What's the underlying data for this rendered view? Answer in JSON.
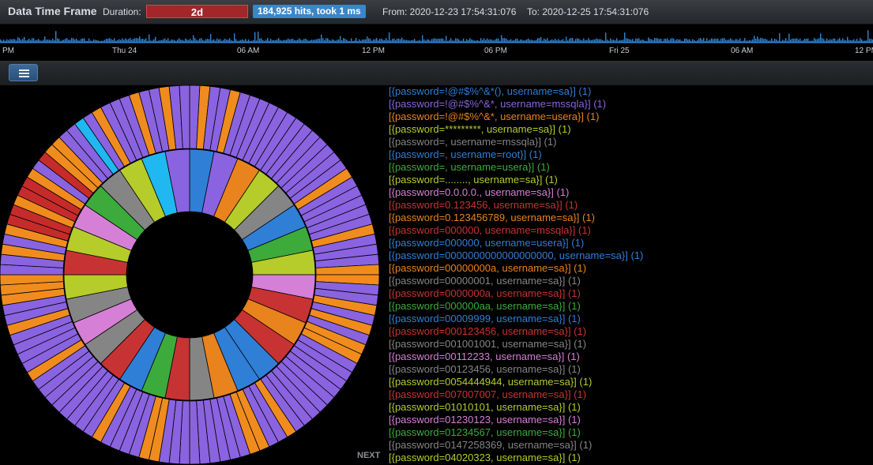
{
  "header": {
    "title": "Data Time Frame",
    "duration_label": "Duration:",
    "duration_value": "2d",
    "hits_badge": "184,925 hits, took 1 ms",
    "from": "From: 2020-12-23 17:54:31:076",
    "to": "To: 2020-12-25 17:54:31:076"
  },
  "timeline": {
    "ticks": [
      "PM",
      "Thu 24",
      "06 AM",
      "12 PM",
      "06 PM",
      "Fri 25",
      "06 AM",
      "12 PM"
    ],
    "bar_color": "#2e86d6"
  },
  "toolbar": {
    "menu_icon": "hamburger-menu-icon"
  },
  "legend": {
    "next_label": "NEXT",
    "items": [
      {
        "text": "[{password=!@#$%^&*(), username=sa}] (1)",
        "color": "#2f7fd6"
      },
      {
        "text": "[{password=!@#$%^&*, username=mssqla}] (1)",
        "color": "#8a63e0"
      },
      {
        "text": "[{password=!@#$%^&*, username=usera}] (1)",
        "color": "#e9831d"
      },
      {
        "text": "[{password=*********, username=sa}] (1)",
        "color": "#b5cc2b"
      },
      {
        "text": "[{password=, username=mssqla}] (1)",
        "color": "#858585"
      },
      {
        "text": "[{password=, username=root}] (1)",
        "color": "#2f7fd6"
      },
      {
        "text": "[{password=, username=usera}] (1)",
        "color": "#3cab3c"
      },
      {
        "text": "[{password=........, username=sa}] (1)",
        "color": "#b5cc2b"
      },
      {
        "text": "[{password=0.0.0.0., username=sa}] (1)",
        "color": "#d67fd6"
      },
      {
        "text": "[{password=0.123456, username=sa}] (1)",
        "color": "#c73333"
      },
      {
        "text": "[{password=0.123456789, username=sa}] (1)",
        "color": "#e9831d"
      },
      {
        "text": "[{password=000000, username=mssqla}] (1)",
        "color": "#c73333"
      },
      {
        "text": "[{password=000000, username=usera}] (1)",
        "color": "#2f7fd6"
      },
      {
        "text": "[{password=0000000000000000000, username=sa}] (1)",
        "color": "#2f7fd6"
      },
      {
        "text": "[{password=00000000a, username=sa}] (1)",
        "color": "#e9831d"
      },
      {
        "text": "[{password=00000001, username=sa}] (1)",
        "color": "#858585"
      },
      {
        "text": "[{password=0000000a, username=sa}] (1)",
        "color": "#c73333"
      },
      {
        "text": "[{password=000000aa, username=sa}] (1)",
        "color": "#3cab3c"
      },
      {
        "text": "[{password=00009999, username=sa}] (1)",
        "color": "#2f7fd6"
      },
      {
        "text": "[{password=000123456, username=sa}] (1)",
        "color": "#c73333"
      },
      {
        "text": "[{password=001001001, username=sa}] (1)",
        "color": "#858585"
      },
      {
        "text": "[{password=00112233, username=sa}] (1)",
        "color": "#d67fd6"
      },
      {
        "text": "[{password=00123456, username=sa}] (1)",
        "color": "#858585"
      },
      {
        "text": "[{password=0054444944, username=sa}] (1)",
        "color": "#b5cc2b"
      },
      {
        "text": "[{password=007007007, username=sa}] (1)",
        "color": "#c73333"
      },
      {
        "text": "[{password=01010101, username=sa}] (1)",
        "color": "#b5cc2b"
      },
      {
        "text": "[{password=01230123, username=sa}] (1)",
        "color": "#d67fd6"
      },
      {
        "text": "[{password=01234567, username=sa}] (1)",
        "color": "#3cab3c"
      },
      {
        "text": "[{password=0147258369, username=sa}] (1)",
        "color": "#858585"
      },
      {
        "text": "[{password=04020323, username=sa}] (1)",
        "color": "#b5cc2b"
      }
    ]
  },
  "donut": {
    "outer_colors": [
      "#8a63e0",
      "#f08c1e",
      "#8a63e0",
      "#8a63e0",
      "#f08c1e",
      "#8a63e0",
      "#8a63e0",
      "#8a63e0",
      "#8a63e0",
      "#8a63e0",
      "#8a63e0",
      "#8a63e0",
      "#8a63e0",
      "#8a63e0",
      "#8a63e0",
      "#8a63e0",
      "#8a63e0",
      "#8a63e0",
      "#f08c1e",
      "#8a63e0",
      "#8a63e0",
      "#8a63e0",
      "#8a63e0",
      "#8a63e0",
      "#f08c1e",
      "#8a63e0",
      "#8a63e0",
      "#8a63e0",
      "#f08c1e",
      "#f08c1e",
      "#8a63e0",
      "#8a63e0",
      "#f08c1e",
      "#8a63e0",
      "#f08c1e",
      "#8a63e0",
      "#f08c1e",
      "#f08c1e",
      "#8a63e0",
      "#8a63e0",
      "#8a63e0",
      "#8a63e0",
      "#8a63e0",
      "#8a63e0",
      "#8a63e0",
      "#8a63e0",
      "#8a63e0",
      "#f08c1e",
      "#8a63e0",
      "#8a63e0",
      "#f08c1e",
      "#f08c1e",
      "#8a63e0",
      "#8a63e0",
      "#8a63e0",
      "#8a63e0",
      "#8a63e0",
      "#8a63e0",
      "#8a63e0",
      "#8a63e0",
      "#8a63e0",
      "#f08c1e",
      "#f08c1e",
      "#8a63e0",
      "#8a63e0",
      "#8a63e0",
      "#8a63e0",
      "#f08c1e",
      "#8a63e0",
      "#8a63e0",
      "#8a63e0",
      "#8a63e0",
      "#8a63e0",
      "#8a63e0",
      "#8a63e0",
      "#8a63e0",
      "#f08c1e",
      "#8a63e0",
      "#8a63e0",
      "#8a63e0",
      "#8a63e0",
      "#f08c1e",
      "#8a63e0",
      "#8a63e0",
      "#f08c1e",
      "#f08c1e",
      "#f08c1e",
      "#8a63e0",
      "#8a63e0",
      "#f08c1e",
      "#8a63e0",
      "#f08c1e",
      "#c62b2b",
      "#c62b2b",
      "#f08c1e",
      "#c62b2b",
      "#c62b2b",
      "#f08c1e",
      "#8a63e0",
      "#c62b2b",
      "#f08c1e",
      "#f08c1e",
      "#8a63e0",
      "#8a63e0",
      "#1fb8f0",
      "#8a63e0",
      "#f08c1e",
      "#8a63e0",
      "#8a63e0",
      "#8a63e0",
      "#f08c1e",
      "#8a63e0",
      "#8a63e0",
      "#f08c1e",
      "#8a63e0",
      "#8a63e0"
    ],
    "inner_colors": [
      "#2f7fd6",
      "#8a63e0",
      "#e9831d",
      "#b5cc2b",
      "#858585",
      "#2f7fd6",
      "#3cab3c",
      "#b5cc2b",
      "#d67fd6",
      "#c73333",
      "#e9831d",
      "#c73333",
      "#2f7fd6",
      "#2f7fd6",
      "#e9831d",
      "#858585",
      "#c73333",
      "#3cab3c",
      "#2f7fd6",
      "#c73333",
      "#858585",
      "#d67fd6",
      "#858585",
      "#b5cc2b",
      "#c73333",
      "#b5cc2b",
      "#d67fd6",
      "#3cab3c",
      "#858585",
      "#b5cc2b",
      "#1fb8f0",
      "#8a63e0"
    ]
  }
}
